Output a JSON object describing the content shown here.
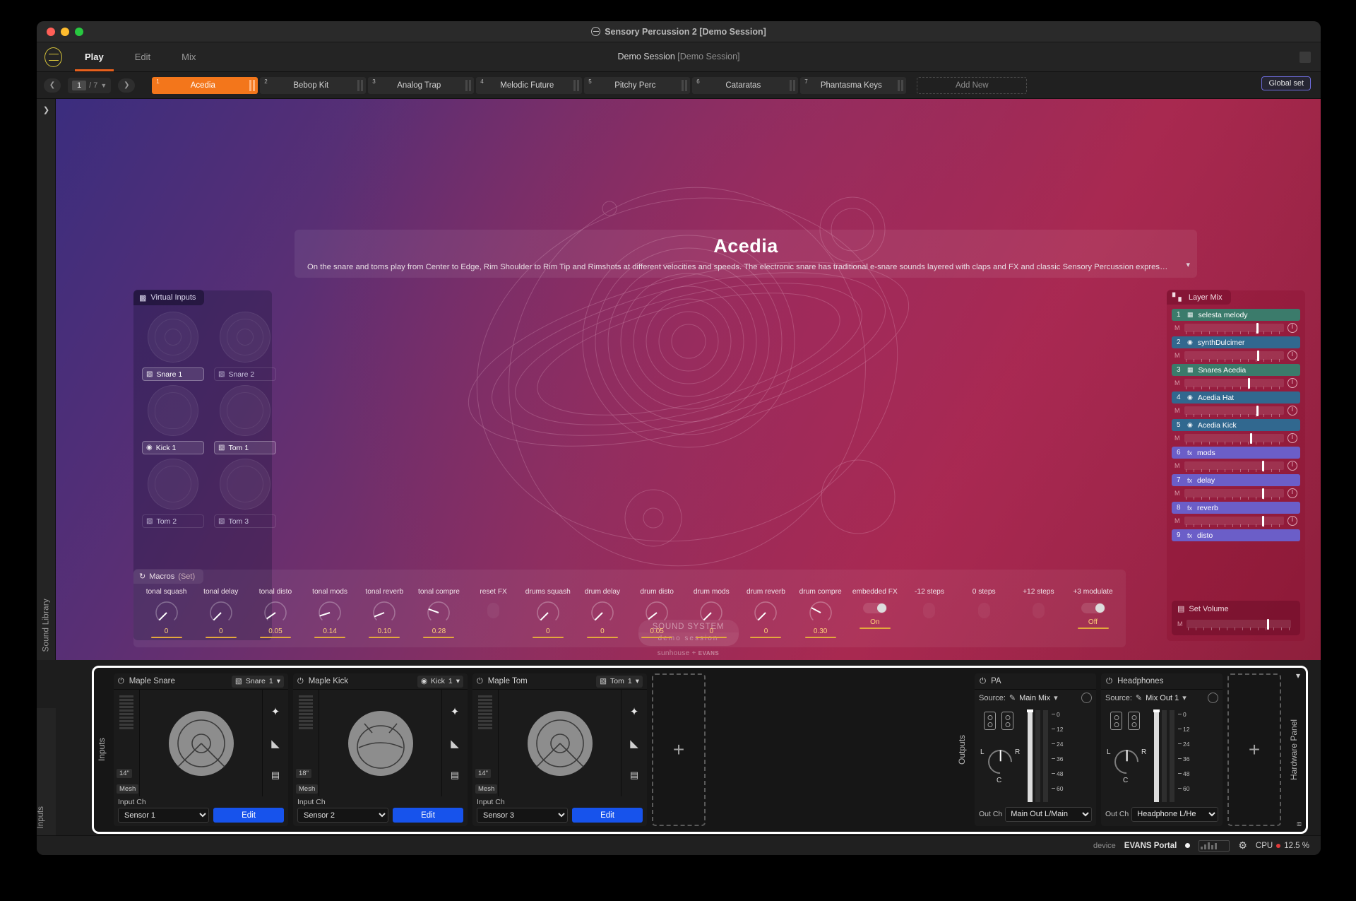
{
  "window": {
    "title": "Sensory Percussion 2 [Demo Session]",
    "logo_icon": "sensory-percussion-logo"
  },
  "menu": {
    "tabs": [
      {
        "label": "Play",
        "active": true
      },
      {
        "label": "Edit",
        "active": false
      },
      {
        "label": "Mix",
        "active": false
      }
    ],
    "session_name": "Demo Session",
    "session_file": "[Demo Session]"
  },
  "kitbar": {
    "prev_icon": "chevron-left-icon",
    "next_icon": "chevron-right-icon",
    "page_current": "1",
    "page_total": "/ 7",
    "page_chevron": "chevron-down-icon",
    "kits": [
      {
        "n": "1",
        "label": "Acedia",
        "active": true
      },
      {
        "n": "2",
        "label": "Bebop Kit",
        "active": false
      },
      {
        "n": "3",
        "label": "Analog Trap",
        "active": false
      },
      {
        "n": "4",
        "label": "Melodic Future",
        "active": false
      },
      {
        "n": "5",
        "label": "Pitchy Perc",
        "active": false
      },
      {
        "n": "6",
        "label": "Cataratas",
        "active": false
      },
      {
        "n": "7",
        "label": "Phantasma Keys",
        "active": false
      }
    ],
    "add_new": "Add New",
    "global_set": "Global set",
    "mute_label": "M"
  },
  "rail": {
    "expand_icon": "chevron-right-icon",
    "sound_library": "Sound Library",
    "inputs": "Inputs"
  },
  "kit_card": {
    "title": "Acedia",
    "description": "On the snare and toms play from Center to Edge, Rim Shoulder to Rim Tip and Rimshots at different velocities and speeds. The electronic snare has traditional e-snare sounds layered with claps and FX and classic Sensory Percussion expressivit...",
    "expand_icon": "chevron-down-icon"
  },
  "artwork": {
    "brand_line1": "SOUND SYSTEM",
    "brand_line2": "demo session",
    "credit_prefix": "sunhouse + ",
    "credit_brand": "EVANS"
  },
  "virtual_inputs": {
    "panel_title": "Virtual Inputs",
    "panel_icon": "drum-pad-icon",
    "pads": [
      {
        "label": "Snare 1",
        "icon": "snare-icon",
        "active": true,
        "art": "snare"
      },
      {
        "label": "Snare 2",
        "icon": "snare-icon",
        "active": false,
        "art": "snare"
      },
      {
        "label": "Kick 1",
        "icon": "kick-icon",
        "active": true,
        "art": "kick"
      },
      {
        "label": "Tom 1",
        "icon": "tom-icon",
        "active": true,
        "art": "tom"
      },
      {
        "label": "Tom 2",
        "icon": "tom-icon",
        "active": false,
        "art": "tom"
      },
      {
        "label": "Tom 3",
        "icon": "tom-icon",
        "active": false,
        "art": "tom"
      }
    ]
  },
  "macros": {
    "panel_title": "Macros",
    "panel_subtitle": "(Set)",
    "panel_icon": "macro-refresh-icon",
    "items": [
      {
        "label": "tonal squash",
        "value": "0",
        "type": "knob",
        "angle": -135
      },
      {
        "label": "tonal delay",
        "value": "0",
        "type": "knob",
        "angle": -135
      },
      {
        "label": "tonal disto",
        "value": "0.05",
        "type": "knob",
        "angle": -125
      },
      {
        "label": "tonal mods",
        "value": "0.14",
        "type": "knob",
        "angle": -108
      },
      {
        "label": "tonal reverb",
        "value": "0.10",
        "type": "knob",
        "angle": -112
      },
      {
        "label": "tonal compre",
        "value": "0.28",
        "type": "knob",
        "angle": -70
      },
      {
        "label": "reset FX",
        "value": "",
        "type": "blank"
      },
      {
        "label": "drums squash",
        "value": "0",
        "type": "knob",
        "angle": -135
      },
      {
        "label": "drum delay",
        "value": "0",
        "type": "knob",
        "angle": -135
      },
      {
        "label": "drum disto",
        "value": "0.05",
        "type": "knob",
        "angle": -128
      },
      {
        "label": "drum mods",
        "value": "0",
        "type": "knob",
        "angle": -135
      },
      {
        "label": "drum reverb",
        "value": "0",
        "type": "knob",
        "angle": -135
      },
      {
        "label": "drum compre",
        "value": "0.30",
        "type": "knob",
        "angle": -62
      },
      {
        "label": "embedded FX",
        "value": "On",
        "type": "toggle",
        "on": true
      },
      {
        "label": "-12 steps",
        "value": "",
        "type": "blank"
      },
      {
        "label": "0 steps",
        "value": "",
        "type": "blank"
      },
      {
        "label": "+12 steps",
        "value": "",
        "type": "blank"
      },
      {
        "label": "+3 modulate",
        "value": "Off",
        "type": "toggle",
        "on": true
      }
    ]
  },
  "layer_mix": {
    "panel_title": "Layer Mix",
    "panel_icon": "bar-chart-icon",
    "mute_label": "M",
    "layers": [
      {
        "n": "1",
        "name": "selesta melody",
        "color": "teal",
        "icon": "sampler-icon",
        "level": 72
      },
      {
        "n": "2",
        "name": "synthDulcimer",
        "color": "blue",
        "icon": "synth-icon",
        "level": 73
      },
      {
        "n": "3",
        "name": "Snares Acedia",
        "color": "teal",
        "icon": "sampler-icon",
        "level": 64
      },
      {
        "n": "4",
        "name": "Acedia Hat",
        "color": "blue",
        "icon": "synth-icon",
        "level": 72
      },
      {
        "n": "5",
        "name": "Acedia Kick",
        "color": "blue",
        "icon": "synth-icon",
        "level": 66
      },
      {
        "n": "6",
        "name": "mods",
        "color": "purple",
        "icon": "fx-icon",
        "level": 78
      },
      {
        "n": "7",
        "name": "delay",
        "color": "purple",
        "icon": "fx-icon",
        "level": 78
      },
      {
        "n": "8",
        "name": "reverb",
        "color": "purple",
        "icon": "fx-icon",
        "level": 78
      },
      {
        "n": "9",
        "name": "disto",
        "color": "purple",
        "icon": "fx-icon",
        "level": 78
      }
    ],
    "set_volume": {
      "label": "Set Volume",
      "icon": "set-volume-icon",
      "mute": "M",
      "level": 77
    }
  },
  "hardware_panel": {
    "vlabel_inputs": "Inputs",
    "vlabel_outputs": "Outputs",
    "vlabel_right": "Hardware Panel",
    "collapse_icon": "chevron-down-icon",
    "resize_icon": "resize-handle-icon",
    "input_ch_label": "Input Ch",
    "edit_label": "Edit",
    "out_ch_label": "Out Ch",
    "source_label": "Source:",
    "add_icon": "plus-icon",
    "pads": [
      {
        "power_icon": "power-icon",
        "name": "Maple Snare",
        "assign_icon": "snare-icon",
        "assign": "Snare",
        "assign_num": "1",
        "size": "14\"",
        "head": "Mesh",
        "input_ch": "Sensor 1",
        "art": "snare",
        "tools": [
          "mesh-texture-icon",
          "sensitivity-icon",
          "drum-profile-icon"
        ]
      },
      {
        "power_icon": "power-icon",
        "name": "Maple Kick",
        "assign_icon": "kick-icon",
        "assign": "Kick",
        "assign_num": "1",
        "size": "18\"",
        "head": "Mesh",
        "input_ch": "Sensor 2",
        "art": "kick",
        "tools": [
          "mesh-texture-icon",
          "sensitivity-icon",
          "drum-profile-icon"
        ]
      },
      {
        "power_icon": "power-icon",
        "name": "Maple Tom",
        "assign_icon": "tom-icon",
        "assign": "Tom",
        "assign_num": "1",
        "size": "14\"",
        "head": "Mesh",
        "input_ch": "Sensor 3",
        "art": "tom",
        "tools": [
          "mesh-texture-icon",
          "sensitivity-icon",
          "drum-profile-icon"
        ]
      }
    ],
    "outputs": [
      {
        "power_icon": "power-icon",
        "name": "PA",
        "source": "Main Mix",
        "out_ch": "Main Out L/Main",
        "pan_l": "L",
        "pan_r": "R",
        "pan_c": "C",
        "scale": [
          "0",
          "12",
          "24",
          "36",
          "48",
          "60"
        ]
      },
      {
        "power_icon": "power-icon",
        "name": "Headphones",
        "source": "Mix Out 1",
        "out_ch": "Headphone L/He",
        "pan_l": "L",
        "pan_r": "R",
        "pan_c": "C",
        "scale": [
          "0",
          "12",
          "24",
          "36",
          "48",
          "60"
        ]
      }
    ]
  },
  "status_bar": {
    "device_label": "device",
    "device_name": "EVANS Portal",
    "gear_icon": "gear-icon",
    "cpu_label": "CPU",
    "cpu_value": "12.5 %"
  }
}
